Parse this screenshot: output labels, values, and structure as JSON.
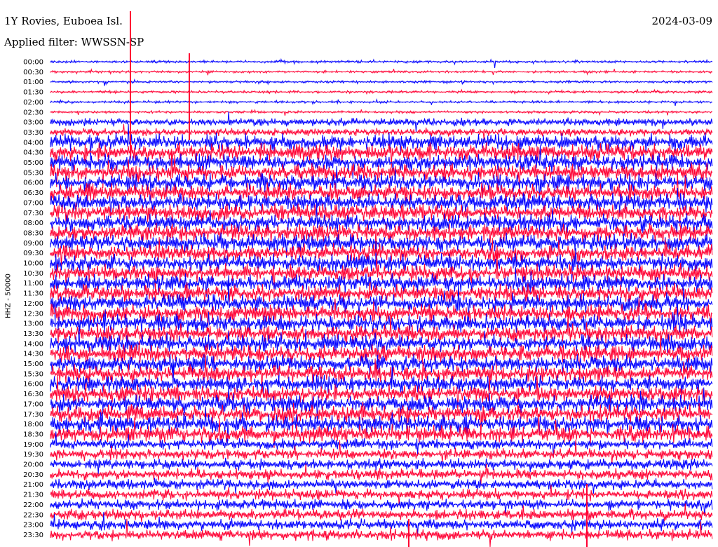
{
  "header": {
    "station": "1Y Rovies, Euboea Isl.",
    "date": "2024-03-09",
    "filter": "Applied filter: WWSSN-SP"
  },
  "chart_data": {
    "type": "line",
    "title": "1Y Rovies, Euboea Isl.",
    "ylabel": "HHZ - 50000",
    "row_labels": [
      "00:00",
      "00:30",
      "01:00",
      "01:30",
      "02:00",
      "02:30",
      "03:00",
      "03:30",
      "04:00",
      "04:30",
      "05:00",
      "05:30",
      "06:00",
      "06:30",
      "07:00",
      "07:30",
      "08:00",
      "08:30",
      "09:00",
      "09:30",
      "10:00",
      "10:30",
      "11:00",
      "11:30",
      "12:00",
      "12:30",
      "13:00",
      "13:30",
      "14:00",
      "14:30",
      "15:00",
      "15:30",
      "16:00",
      "16:30",
      "17:00",
      "17:30",
      "18:00",
      "18:30",
      "19:00",
      "19:30",
      "20:00",
      "20:30",
      "21:00",
      "21:30",
      "22:00",
      "22:30",
      "23:00",
      "23:30"
    ],
    "colors": [
      "#0000ff",
      "#ff0033"
    ],
    "grid": false
  }
}
